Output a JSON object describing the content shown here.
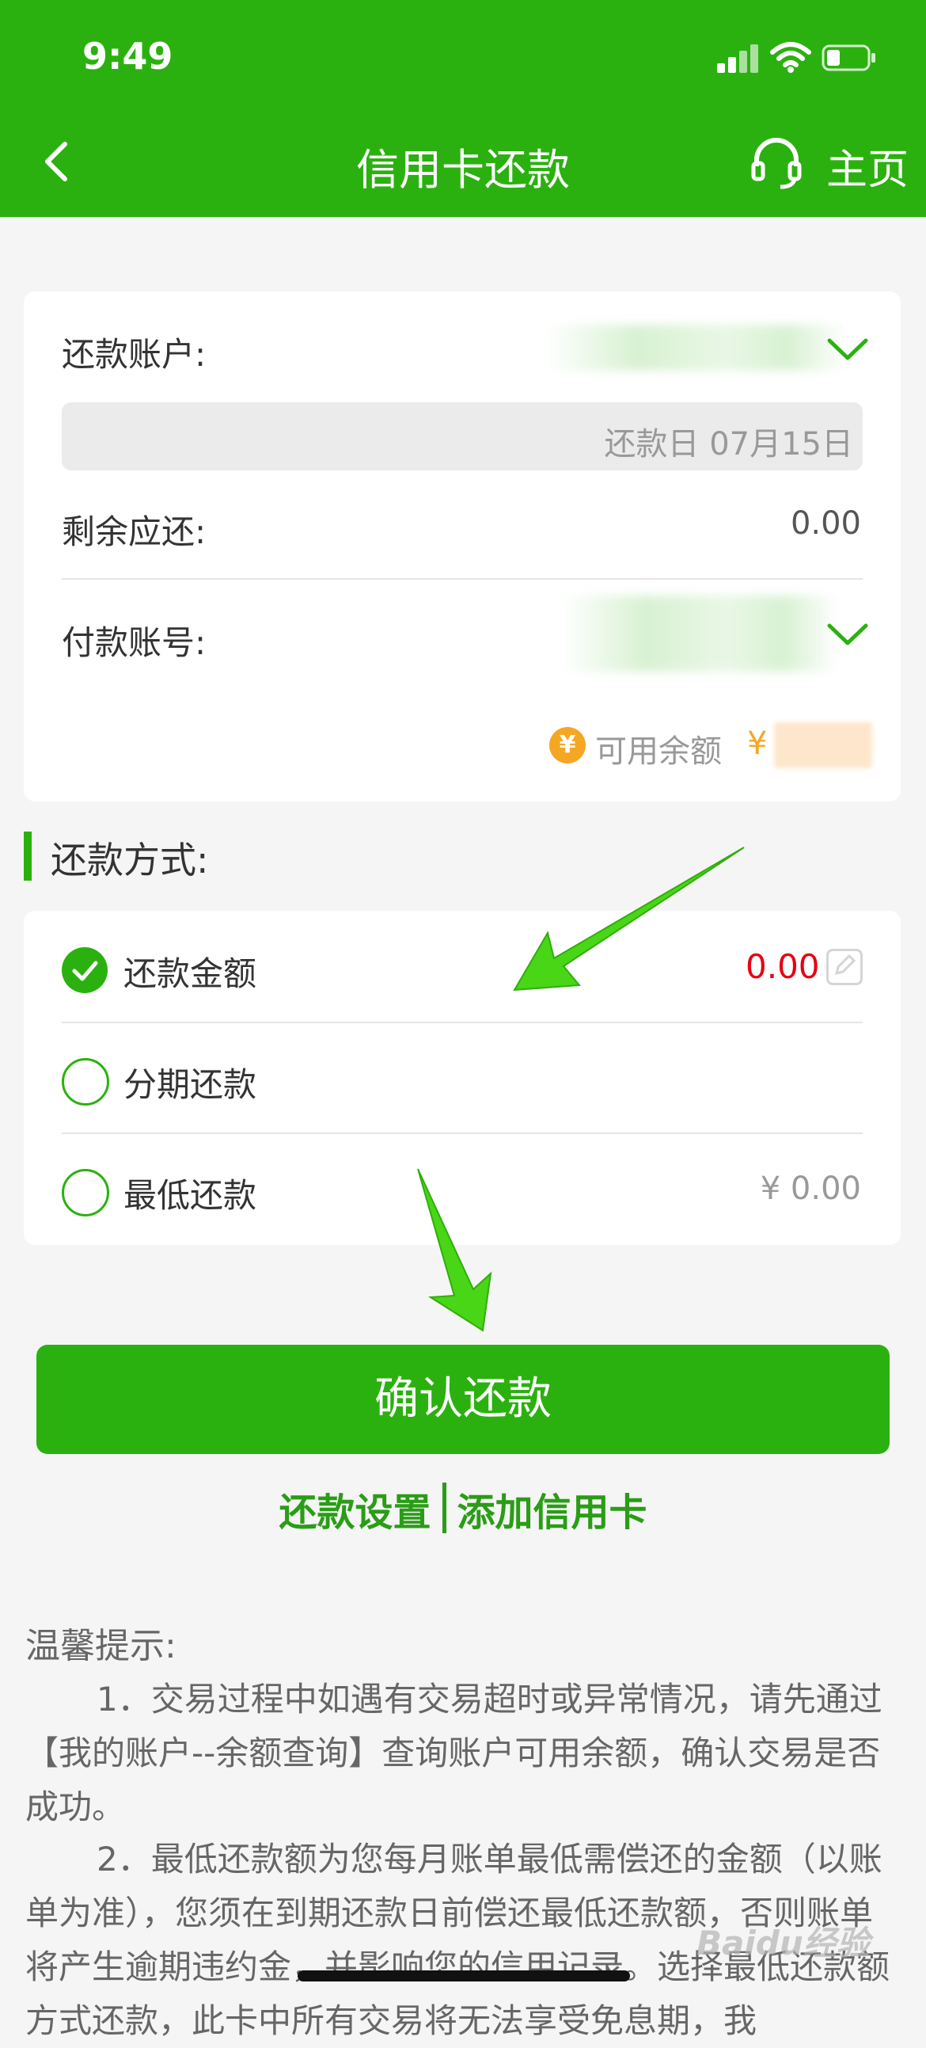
{
  "status_bar": {
    "time": "9:49"
  },
  "nav": {
    "title": "信用卡还款",
    "home_label": "主页"
  },
  "account_card": {
    "repay_account_label": "还款账户:",
    "due_text": "还款日 07月15日",
    "remaining_label": "剩余应还:",
    "remaining_value": "0.00",
    "pay_account_label": "付款账号:",
    "coin_symbol": "¥",
    "available_label": "可用余额",
    "available_currency": "¥"
  },
  "repay_method": {
    "section_title": "还款方式:",
    "options": [
      {
        "label": "还款金额",
        "value": "0.00",
        "selected": true
      },
      {
        "label": "分期还款",
        "value": "",
        "selected": false
      },
      {
        "label": "最低还款",
        "value": "¥ 0.00",
        "selected": false
      }
    ]
  },
  "actions": {
    "confirm_label": "确认还款",
    "settings_link": "还款设置",
    "add_card_link": "添加信用卡"
  },
  "tips": {
    "title": "温馨提示:",
    "item1": "1．交易过程中如遇有交易超时或异常情况，请先通过【我的账户--余额查询】查询账户可用余额，确认交易是否成功。",
    "item2": "2．最低还款额为您每月账单最低需偿还的金额（以账单为准），您须在到期还款日前偿还最低还款额，否则账单将产生逾期违约金，并影响您的信用记录。选择最低还款额方式还款，此卡中所有交易将无法享受免息期，我"
  },
  "watermark": "Baidu经验",
  "colors": {
    "primary": "#2bb10f",
    "amount_red": "#e60012",
    "coin_orange": "#f5a623"
  },
  "icons": [
    "back-icon",
    "headset-icon",
    "chevron-down-icon",
    "coin-icon",
    "check-icon",
    "edit-icon"
  ]
}
